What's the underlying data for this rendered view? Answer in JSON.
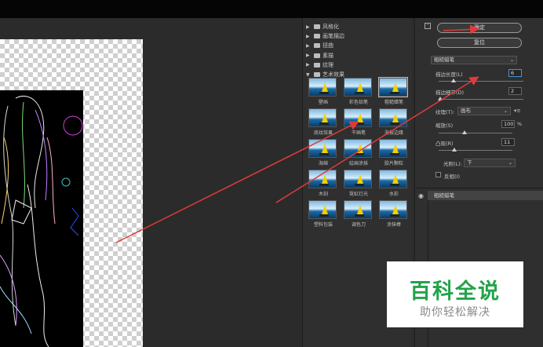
{
  "gallery": {
    "folders": [
      {
        "label": "风格化",
        "expanded": false
      },
      {
        "label": "画笔描边",
        "expanded": false
      },
      {
        "label": "扭曲",
        "expanded": false
      },
      {
        "label": "素描",
        "expanded": false
      },
      {
        "label": "纹理",
        "expanded": false
      },
      {
        "label": "艺术效果",
        "expanded": true
      }
    ],
    "filters": [
      {
        "label": "壁画"
      },
      {
        "label": "彩色铅笔"
      },
      {
        "label": "粗糙蜡笔",
        "selected": true
      },
      {
        "label": "底纹效果"
      },
      {
        "label": "干画笔"
      },
      {
        "label": "海报边缘"
      },
      {
        "label": "海绵"
      },
      {
        "label": "绘画涂抹"
      },
      {
        "label": "胶片颗粒"
      },
      {
        "label": "木刻"
      },
      {
        "label": "霓虹灯光"
      },
      {
        "label": "水彩"
      },
      {
        "label": "塑料包装"
      },
      {
        "label": "调色刀"
      },
      {
        "label": "涂抹棒"
      }
    ]
  },
  "panel": {
    "ok_label": "确定",
    "reset_label": "复位",
    "filter_select": "粗糙蜡笔",
    "params": {
      "stroke_length": {
        "label": "描边长度(L)",
        "value": "6"
      },
      "stroke_detail": {
        "label": "描边细节(D)",
        "value": "2"
      },
      "texture": {
        "label": "纹理(T):",
        "value": "画布"
      },
      "scaling": {
        "label": "缩放(S)",
        "value": "100",
        "unit": "%"
      },
      "relief": {
        "label": "凸现(R)",
        "value": "11"
      },
      "light": {
        "label": "光照(L):",
        "value": "下"
      },
      "invert": {
        "label": "反相(I)",
        "checked": false
      }
    },
    "layer_name": "粗糙蜡笔"
  },
  "watermark": {
    "main": "百科全说",
    "sub": "助你轻松解决"
  },
  "colors": {
    "annotation_arrow": "#e03b3b",
    "watermark_green": "#22a34a"
  }
}
